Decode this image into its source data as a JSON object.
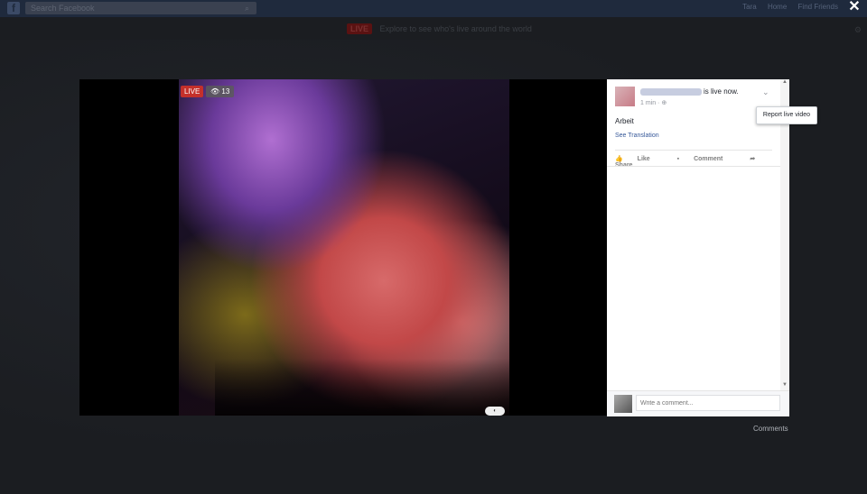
{
  "topbar": {
    "search_placeholder": "Search Facebook",
    "right_items": [
      "Tara",
      "Home",
      "Find Friends"
    ],
    "close_symbol": "✕"
  },
  "banner": {
    "tag": "LIVE",
    "text": "Explore to see who's live around the world"
  },
  "video": {
    "live_badge": "LIVE",
    "viewer_count": "13"
  },
  "post": {
    "status_text": "is live now.",
    "time": "1 min · ",
    "text": "Arbeit",
    "see_translation": "See Translation",
    "actions": {
      "like": "Like",
      "comment": "Comment",
      "share": "Share"
    },
    "comment_placeholder": "Write a comment..."
  },
  "menu": {
    "report_live_video": "Report live video"
  },
  "footer": {
    "comments_label": "Comments"
  },
  "icons": {
    "eye": "eye-icon",
    "globe": "globe-icon",
    "chevron": "chevron-down-icon",
    "like": "thumbs-up-icon",
    "comment": "comment-icon",
    "share": "share-arrow-icon",
    "close": "close-icon",
    "search": "search-icon"
  },
  "colors": {
    "live_red": "#c4302b",
    "link_blue": "#365899",
    "topbar": "#1f2a3d"
  }
}
